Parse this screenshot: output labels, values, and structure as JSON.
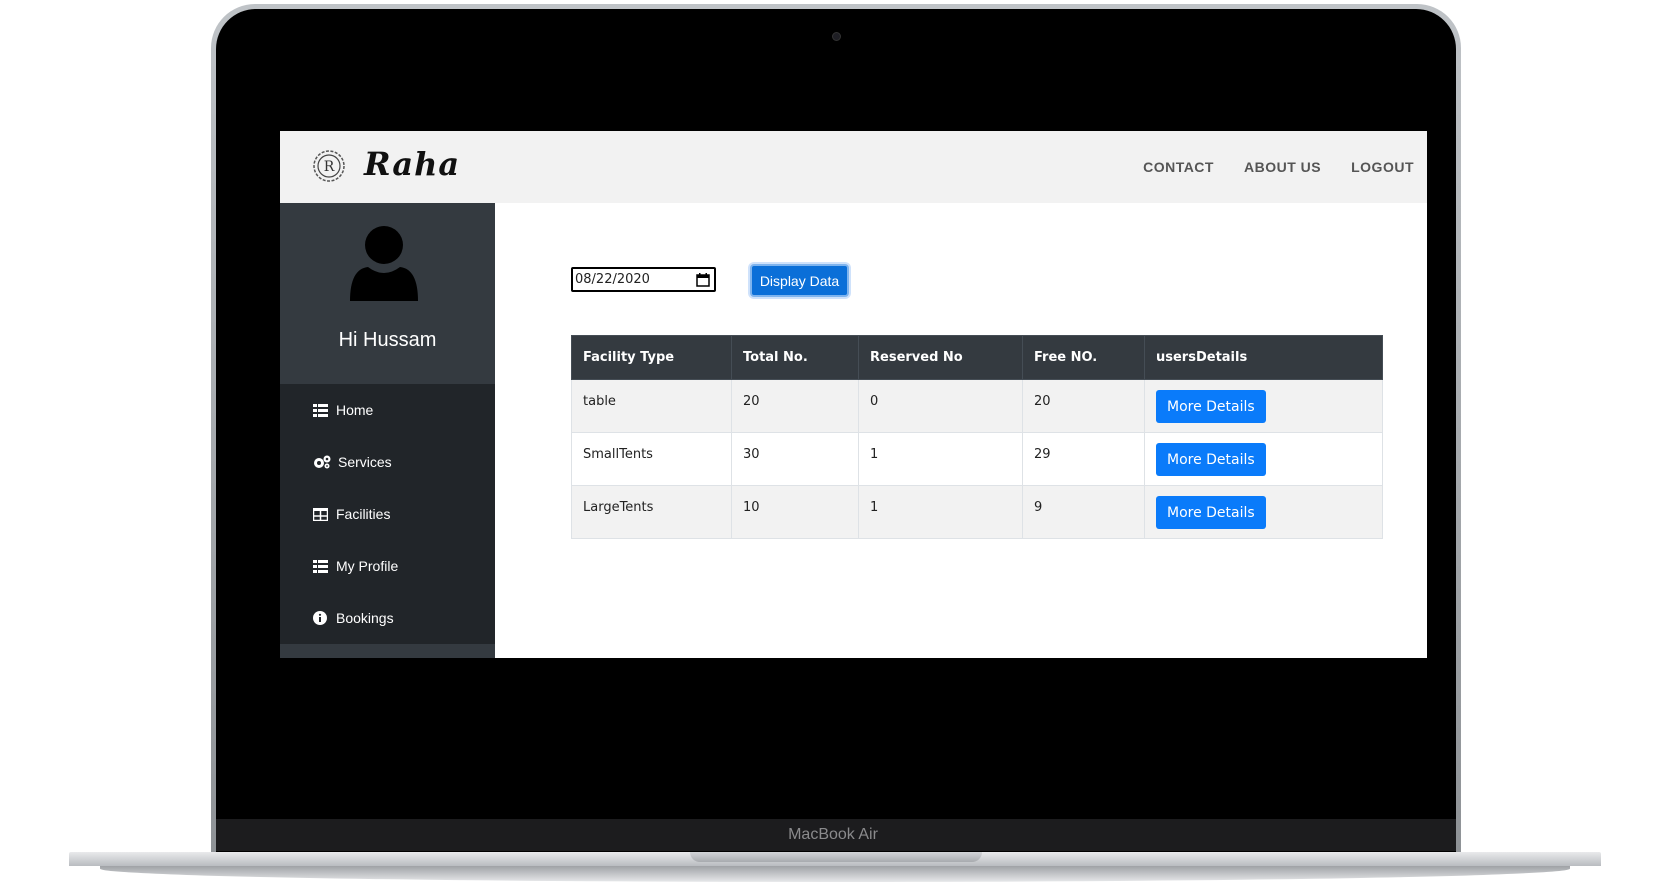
{
  "device": {
    "label": "MacBook Air"
  },
  "header": {
    "brand": "Raha",
    "logo_letter": "R",
    "nav": [
      {
        "label": "CONTACT"
      },
      {
        "label": "ABOUT US"
      },
      {
        "label": "LOGOUT"
      }
    ]
  },
  "sidebar": {
    "greeting": "Hi Hussam",
    "items": [
      {
        "label": "Home",
        "icon": "grid-icon"
      },
      {
        "label": "Services",
        "icon": "gears-icon"
      },
      {
        "label": "Facilities",
        "icon": "table-icon"
      },
      {
        "label": "My Profile",
        "icon": "grid-icon"
      },
      {
        "label": "Bookings",
        "icon": "info-icon"
      }
    ]
  },
  "filter": {
    "date_value": "08/22/2020",
    "display_button": "Display Data"
  },
  "table": {
    "headers": [
      "Facility Type",
      "Total No.",
      "Reserved No",
      "Free NO.",
      "usersDetails"
    ],
    "rows": [
      {
        "type": "table",
        "total": "20",
        "reserved": "0",
        "free": "20",
        "action": "More Details"
      },
      {
        "type": "SmallTents",
        "total": "30",
        "reserved": "1",
        "free": "29",
        "action": "More Details"
      },
      {
        "type": "LargeTents",
        "total": "10",
        "reserved": "1",
        "free": "9",
        "action": "More Details"
      }
    ]
  },
  "colors": {
    "sidebar_bg": "#212529",
    "profile_bg": "#343a40",
    "table_header_bg": "#343a40",
    "primary_button": "#0a7bfa"
  }
}
